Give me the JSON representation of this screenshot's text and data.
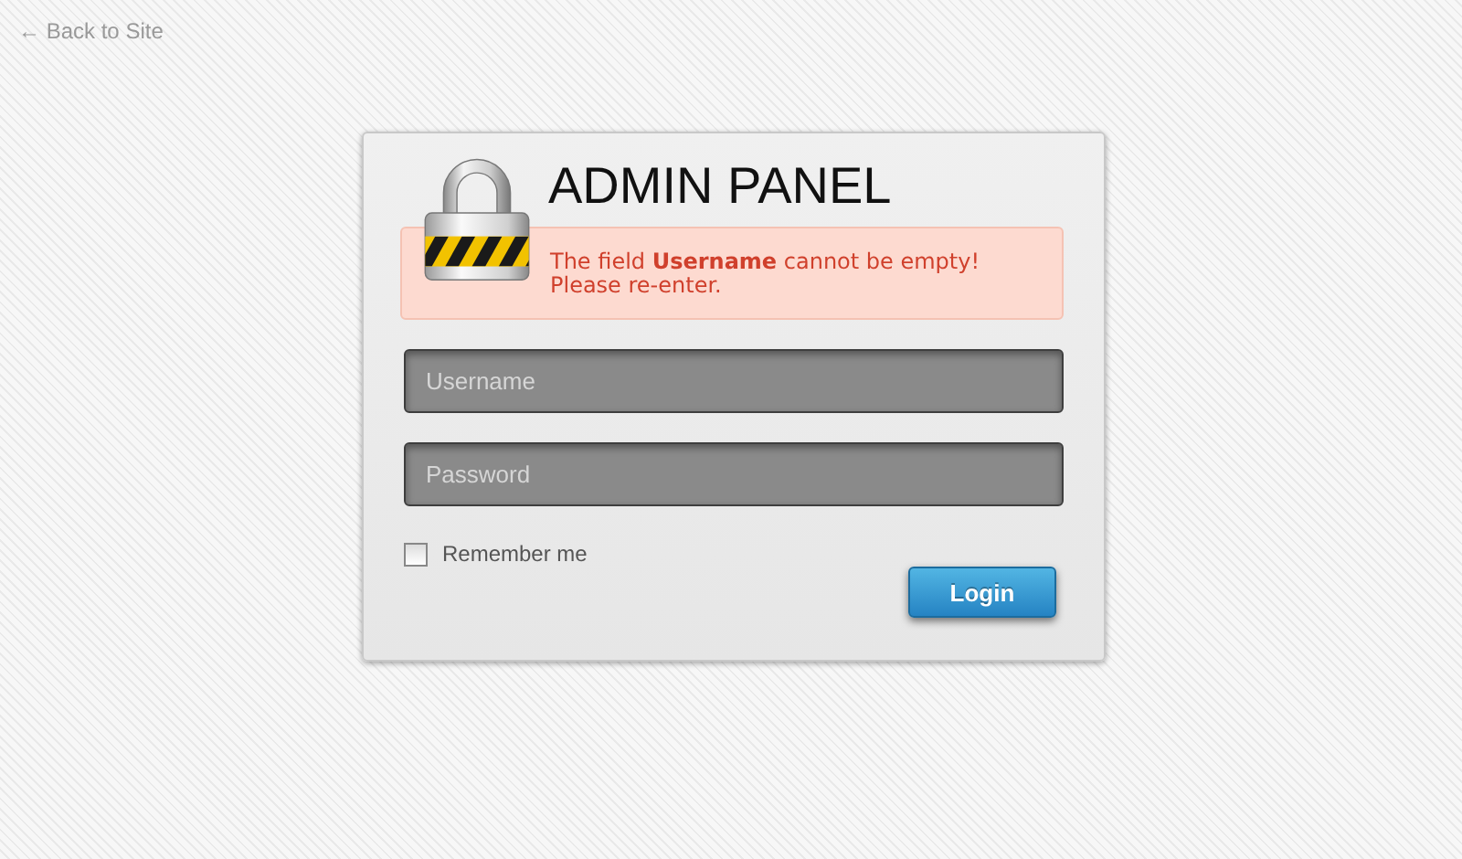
{
  "back_link": "← Back to Site",
  "panel": {
    "title": "ADMIN PANEL",
    "error": "The field **Username** cannot be empty! Please re-enter.",
    "username": {
      "placeholder": "Username"
    },
    "password": {
      "placeholder": "Password"
    },
    "remember": {
      "label": "Remember me",
      "checked": false
    },
    "login_button": "Login"
  }
}
